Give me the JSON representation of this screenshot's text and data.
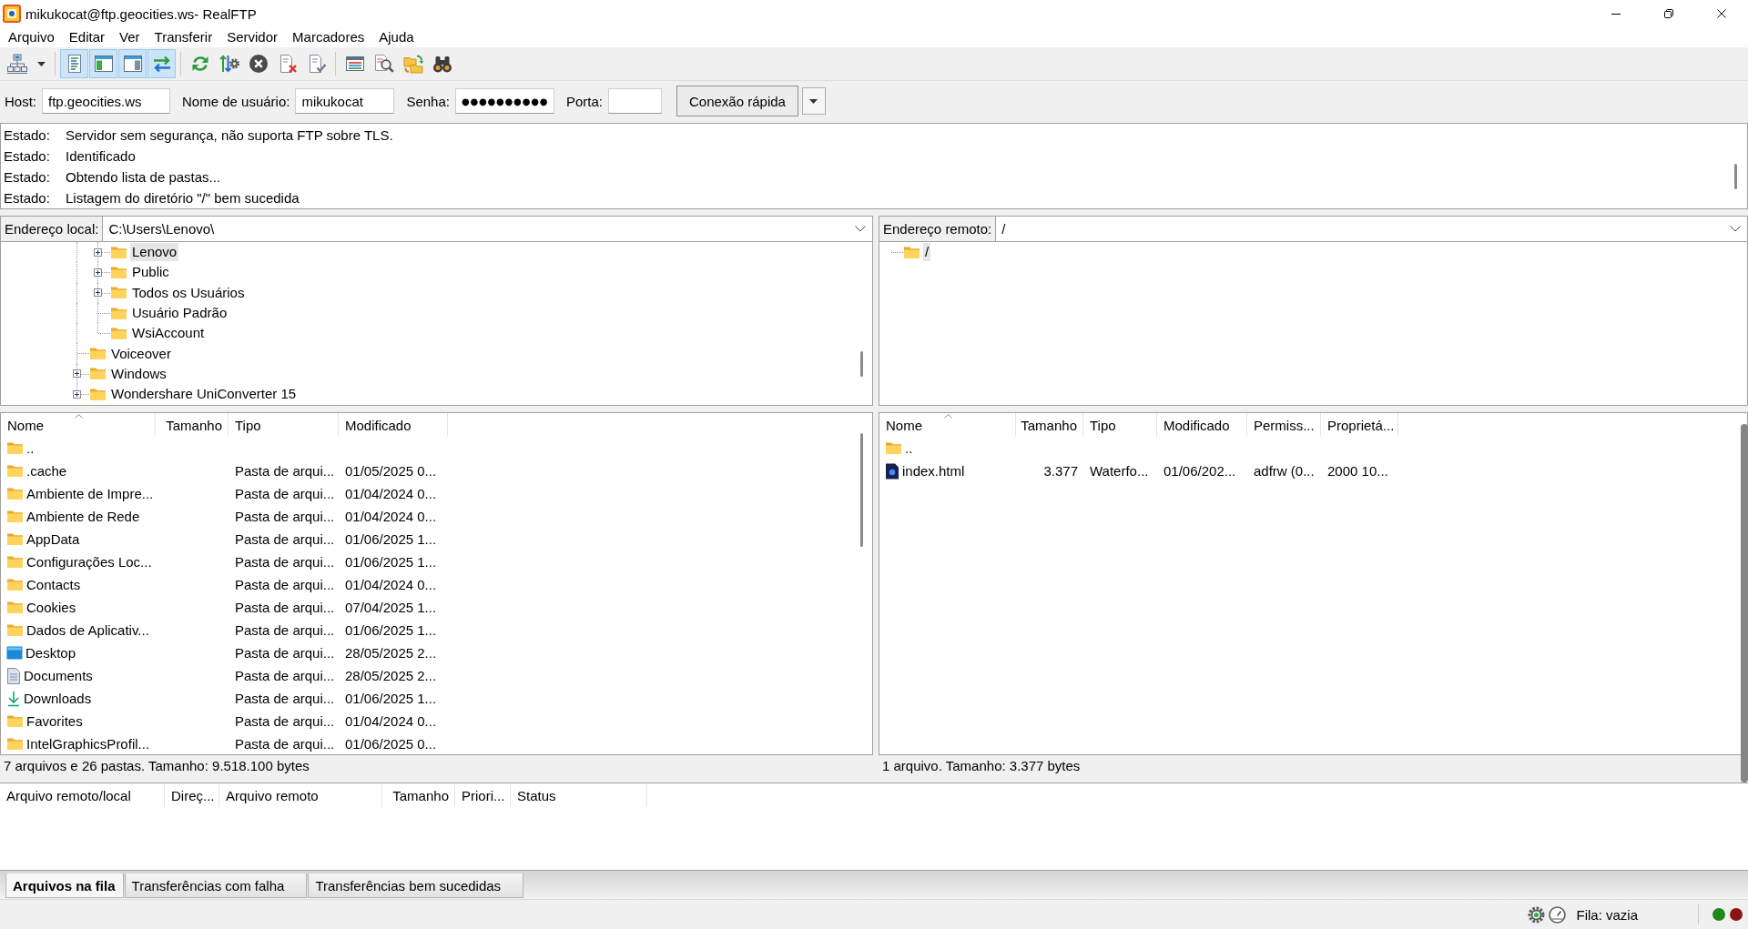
{
  "window": {
    "title": "mikukocat@ftp.geocities.ws- RealFTP"
  },
  "menu": [
    {
      "label": "Arquivo"
    },
    {
      "label": "Editar"
    },
    {
      "label": "Ver"
    },
    {
      "label": "Transferir"
    },
    {
      "label": "Servidor"
    },
    {
      "label": "Marcadores"
    },
    {
      "label": "Ajuda"
    }
  ],
  "toolbar": {
    "groups": [
      {
        "buttons": [
          {
            "kind": "sitemanager",
            "pressed": false
          },
          {
            "kind": "dropdown",
            "pressed": false
          }
        ]
      },
      {
        "buttons": [
          {
            "kind": "messagelog",
            "pressed": true
          },
          {
            "kind": "localtree",
            "pressed": true
          },
          {
            "kind": "remotetree",
            "pressed": true
          },
          {
            "kind": "queue",
            "pressed": true
          }
        ]
      },
      {
        "buttons": [
          {
            "kind": "refresh",
            "pressed": false
          },
          {
            "kind": "processqueue",
            "pressed": false
          },
          {
            "kind": "cancel",
            "pressed": false
          },
          {
            "kind": "disconnect",
            "pressed": false
          },
          {
            "kind": "reconnect",
            "pressed": false
          }
        ]
      },
      {
        "buttons": [
          {
            "kind": "filter",
            "pressed": false
          },
          {
            "kind": "compare",
            "pressed": false
          },
          {
            "kind": "syncbrowse",
            "pressed": false
          },
          {
            "kind": "search",
            "pressed": false
          }
        ]
      }
    ]
  },
  "quickconnect": {
    "fields": [
      {
        "label": "Host:",
        "kind": "text",
        "value": "ftp.geocities.ws"
      },
      {
        "label": "Nome de usuário:",
        "kind": "text",
        "value": "mikukocat"
      },
      {
        "label": "Senha:",
        "kind": "password",
        "value": "●●●●●●●●●●"
      },
      {
        "label": "Porta:",
        "kind": "text"
      }
    ],
    "button": {
      "label": "Conexão rápida"
    }
  },
  "log": [
    {
      "label": "Estado:",
      "text": "Servidor sem segurança, não suporta FTP sobre TLS."
    },
    {
      "label": "Estado:",
      "text": "Identificado"
    },
    {
      "label": "Estado:",
      "text": "Obtendo lista de pastas..."
    },
    {
      "label": "Estado:",
      "text": "Listagem do diretório \"/\" bem sucedida"
    }
  ],
  "local": {
    "address": {
      "label": "Endereço local:",
      "value": "C:\\Users\\Lenovo\\"
    },
    "tree": [
      {
        "children": [
          {
            "label": "Lenovo",
            "expandable": true,
            "selected": true
          },
          {
            "label": "Public",
            "expandable": true,
            "selected": false
          },
          {
            "label": "Todos os Usuários",
            "expandable": true,
            "selected": false
          },
          {
            "label": "Usuário Padrão",
            "expandable": false,
            "selected": false
          },
          {
            "label": "WsiAccount",
            "expandable": false,
            "selected": false
          }
        ]
      },
      {
        "label": "Voiceover",
        "expandable": false,
        "selected": false
      },
      {
        "label": "Windows",
        "expandable": true,
        "selected": false
      },
      {
        "label": "Wondershare UniConverter 15",
        "expandable": true,
        "selected": false
      }
    ],
    "files": {
      "columns": [
        {
          "label": "Nome",
          "sorted": true
        },
        {
          "label": "Tamanho",
          "sorted": false
        },
        {
          "label": "Tipo",
          "sorted": false
        },
        {
          "label": "Modificado",
          "sorted": false
        }
      ],
      "rows": [
        {
          "kind": "folder",
          "name": ".."
        },
        {
          "kind": "folder",
          "name": ".cache",
          "type": "Pasta de arqui...",
          "modified": "01/05/2025 0..."
        },
        {
          "kind": "folder",
          "name": "Ambiente de Impre...",
          "type": "Pasta de arqui...",
          "modified": "01/04/2024 0..."
        },
        {
          "kind": "folder",
          "name": "Ambiente de Rede",
          "type": "Pasta de arqui...",
          "modified": "01/04/2024 0..."
        },
        {
          "kind": "folder",
          "name": "AppData",
          "type": "Pasta de arqui...",
          "modified": "01/06/2025 1..."
        },
        {
          "kind": "folder",
          "name": "Configurações Loc...",
          "type": "Pasta de arqui...",
          "modified": "01/06/2025 1..."
        },
        {
          "kind": "folder",
          "name": "Contacts",
          "type": "Pasta de arqui...",
          "modified": "01/04/2024 0..."
        },
        {
          "kind": "folder",
          "name": "Cookies",
          "type": "Pasta de arqui...",
          "modified": "07/04/2025 1..."
        },
        {
          "kind": "folder",
          "name": "Dados de Aplicativ...",
          "type": "Pasta de arqui...",
          "modified": "01/06/2025 1..."
        },
        {
          "kind": "desktop",
          "name": "Desktop",
          "type": "Pasta de arqui...",
          "modified": "28/05/2025 2..."
        },
        {
          "kind": "documents",
          "name": "Documents",
          "type": "Pasta de arqui...",
          "modified": "28/05/2025 2..."
        },
        {
          "kind": "downloads",
          "name": "Downloads",
          "type": "Pasta de arqui...",
          "modified": "01/06/2025 1..."
        },
        {
          "kind": "folder",
          "name": "Favorites",
          "type": "Pasta de arqui...",
          "modified": "01/04/2024 0..."
        },
        {
          "kind": "folder",
          "name": "IntelGraphicsProfil...",
          "type": "Pasta de arqui...",
          "modified": "01/06/2025 0..."
        }
      ]
    },
    "summary": "7 arquivos e 26 pastas. Tamanho: 9.518.100 bytes"
  },
  "remote": {
    "address": {
      "label": "Endereço remoto:",
      "value": "/"
    },
    "tree": [
      {
        "label": "/",
        "expandable": false,
        "selected": true
      }
    ],
    "files": {
      "columns": [
        {
          "label": "Nome",
          "sorted": true
        },
        {
          "label": "Tamanho",
          "sorted": false
        },
        {
          "label": "Tipo",
          "sorted": false
        },
        {
          "label": "Modificado",
          "sorted": false
        },
        {
          "label": "Permiss...",
          "sorted": false
        },
        {
          "label": "Proprietá...",
          "sorted": false
        }
      ],
      "rows": [
        {
          "kind": "folder",
          "name": ".."
        },
        {
          "kind": "file",
          "name": "index.html",
          "size": "3.377",
          "type": "Waterfo...",
          "modified": "01/06/202...",
          "permissions": "adfrw (0...",
          "owner": "2000 10..."
        }
      ]
    },
    "summary": "1 arquivo. Tamanho: 3.377 bytes"
  },
  "queue": {
    "columns": [
      {
        "label": "Arquivo remoto/local"
      },
      {
        "label": "Direç..."
      },
      {
        "label": "Arquivo remoto"
      },
      {
        "label": "Tamanho"
      },
      {
        "label": "Priori..."
      },
      {
        "label": "Status"
      }
    ],
    "tabs": [
      {
        "label": "Arquivos na fila",
        "selected": true
      },
      {
        "label": "Transferências com falha",
        "selected": false
      },
      {
        "label": "Transferências bem sucedidas",
        "selected": false
      }
    ]
  },
  "status_bar": {
    "text": "Fila: vazia",
    "lights": [
      {
        "color": "#1c8a1c"
      },
      {
        "color": "#8e1414"
      }
    ]
  }
}
